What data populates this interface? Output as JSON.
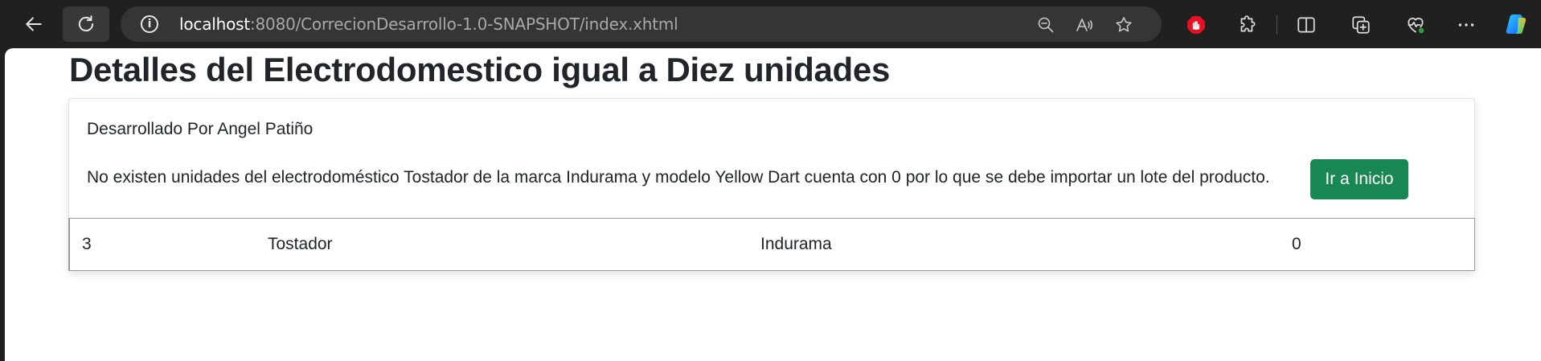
{
  "browser": {
    "url_host": "localhost",
    "url_path": ":8080/CorrecionDesarrollo-1.0-SNAPSHOT/index.xhtml",
    "icons": [
      "back-arrow-icon",
      "reload-icon",
      "site-info-icon",
      "zoom-out-icon",
      "read-aloud-icon",
      "favorite-star-icon",
      "adblock-icon",
      "extensions-icon",
      "split-screen-icon",
      "collections-icon",
      "browser-essentials-icon",
      "more-menu-icon",
      "copilot-icon"
    ]
  },
  "page": {
    "title": "Detalles del Electrodomestico igual a Diez unidades",
    "developer_credit": "Desarrollado Por Angel Patiño",
    "message": "No existen unidades del electrodoméstico Tostador de la marca Indurama y modelo Yellow Dart cuenta con 0 por lo que se debe importar un lote del producto.",
    "home_button_label": "Ir a Inicio"
  },
  "table": {
    "rows": [
      {
        "id": "3",
        "name": "Tostador",
        "brand": "Indurama",
        "units": "0"
      }
    ]
  },
  "colors": {
    "chrome_bg": "#202020",
    "address_bar_bg": "#353535",
    "button_green": "#198754",
    "adblock_red": "#e81123"
  }
}
